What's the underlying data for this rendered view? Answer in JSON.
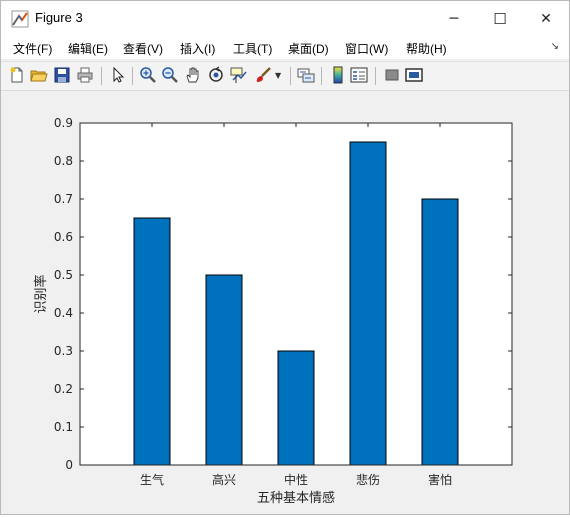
{
  "window": {
    "title": "Figure 3",
    "controls": {
      "minimize": "─",
      "maximize": "☐",
      "close": "✕"
    }
  },
  "menubar": {
    "items": [
      "文件(F)",
      "编辑(E)",
      "查看(V)",
      "插入(I)",
      "工具(T)",
      "桌面(D)",
      "窗口(W)",
      "帮助(H)"
    ],
    "overflow_icon": "curved-arrow-icon"
  },
  "toolbar": {
    "icons": [
      "new-figure-icon",
      "open-file-icon",
      "save-icon",
      "print-icon",
      "edit-plot-arrow-icon",
      "zoom-in-icon",
      "zoom-out-icon",
      "pan-hand-icon",
      "rotate-3d-icon",
      "data-cursor-icon",
      "brush-icon",
      "brush-dropdown-icon",
      "link-plot-icon",
      "insert-colorbar-icon",
      "insert-legend-icon",
      "hide-plot-tools-icon",
      "show-plot-tools-icon"
    ]
  },
  "colors": {
    "bar": "#0072BD",
    "axes_bg": "#ffffff",
    "figure_bg": "#f0f0f0",
    "title_accent": "#d95319"
  },
  "chart_data": {
    "type": "bar",
    "categories": [
      "生气",
      "高兴",
      "中性",
      "悲伤",
      "害怕"
    ],
    "values": [
      0.65,
      0.5,
      0.3,
      0.85,
      0.7
    ],
    "xlabel": "五种基本情感",
    "ylabel": "识别率",
    "ylim": [
      0,
      0.9
    ],
    "yticks": [
      "0",
      "0.1",
      "0.2",
      "0.3",
      "0.4",
      "0.5",
      "0.6",
      "0.7",
      "0.8",
      "0.9"
    ],
    "grid": false,
    "legend": "none"
  }
}
